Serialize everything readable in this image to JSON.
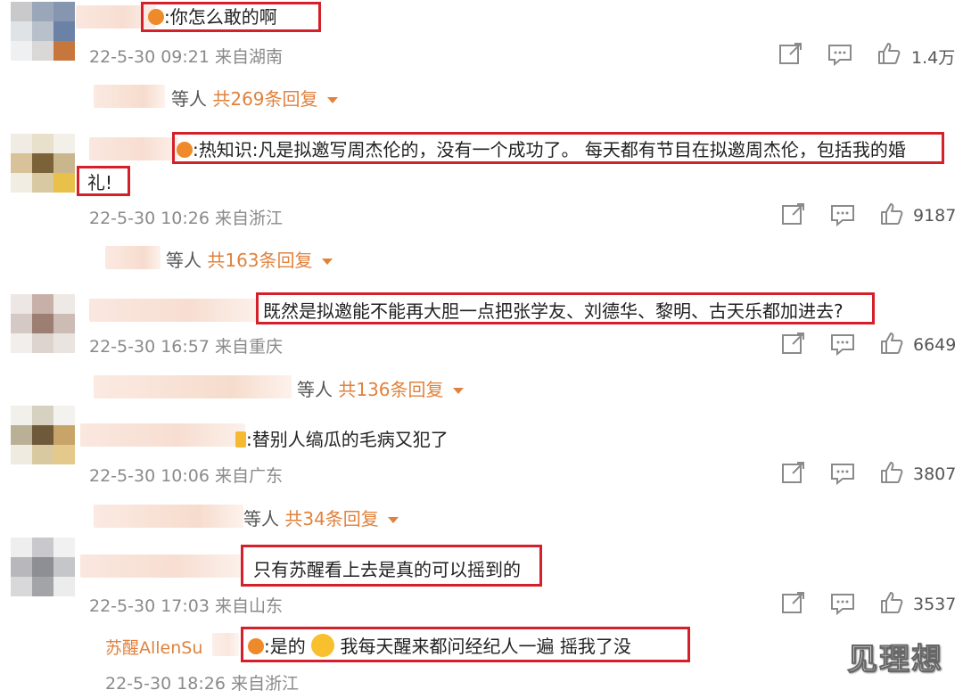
{
  "comments": [
    {
      "text": ":你怎么敢的啊",
      "time": "22-5-30 09:21",
      "source": "来自湖南",
      "likes": "1.4万",
      "reply_prefix": "等人",
      "reply_count": "共269条回复"
    },
    {
      "text": ":热知识:凡是拟邀写周杰伦的，没有一个成功了。 每天都有节目在拟邀周杰伦，包括我的婚",
      "text2": "礼!",
      "time": "22-5-30 10:26",
      "source": "来自浙江",
      "likes": "9187",
      "reply_prefix": "等人",
      "reply_count": "共163条回复"
    },
    {
      "text": "既然是拟邀能不能再大胆一点把张学友、刘德华、黎明、古天乐都加进去?",
      "time": "22-5-30 16:57",
      "source": "来自重庆",
      "likes": "6649",
      "reply_prefix": "等人",
      "reply_count": "共136条回复"
    },
    {
      "text": ":替别人缟瓜的毛病又犯了",
      "time": "22-5-30 10:06",
      "source": "来自广东",
      "likes": "3807",
      "reply_prefix": "等人",
      "reply_count": "共34条回复"
    },
    {
      "text": "只有苏醒看上去是真的可以摇到的",
      "time": "22-5-30 17:03",
      "source": "来自山东",
      "likes": "3537"
    }
  ],
  "reply": {
    "user": "苏醒AllenSu",
    "text_a": ":是的",
    "text_b": "我每天醒来都问经纪人一遍 摇我了没",
    "time": "22-5-30 18:26",
    "source": "来自浙江"
  },
  "watermark": "见理想",
  "colors": {
    "highlight_box": "#d4202a",
    "accent": "#e0823d",
    "meta": "#8a8a8a"
  },
  "icons": [
    "share-icon",
    "comment-icon",
    "like-icon",
    "chevron-down-icon",
    "emoji-icon"
  ]
}
